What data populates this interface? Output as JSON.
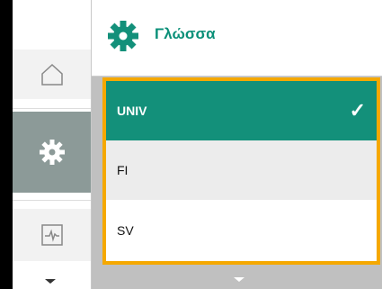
{
  "header": {
    "title": "Γλώσσα",
    "icon": "gear-icon",
    "accent": "#13907a"
  },
  "sidebar": {
    "items": [
      {
        "name": "home",
        "icon": "home-icon",
        "active": false
      },
      {
        "name": "settings",
        "icon": "gear-icon",
        "active": true
      },
      {
        "name": "status",
        "icon": "waveform-icon",
        "active": false
      }
    ]
  },
  "language_list": {
    "items": [
      {
        "label": "UNIV",
        "selected": true
      },
      {
        "label": "FI",
        "selected": false
      },
      {
        "label": "SV",
        "selected": false
      }
    ],
    "check": "✓",
    "highlight": "#f5a800"
  }
}
